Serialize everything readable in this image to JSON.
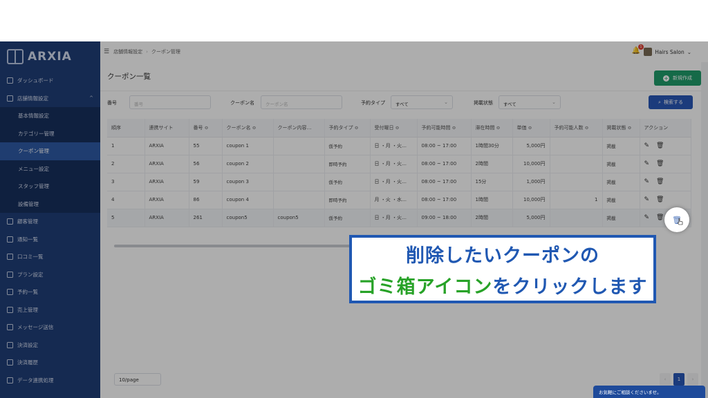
{
  "brand": "ARXIA",
  "sidebar": {
    "items": [
      {
        "label": "ダッシュボード"
      },
      {
        "label": "店舗情報設定",
        "expanded": true
      },
      {
        "label": "顧客管理"
      },
      {
        "label": "通知一覧"
      },
      {
        "label": "口コミ一覧"
      },
      {
        "label": "プラン設定"
      },
      {
        "label": "予約一覧"
      },
      {
        "label": "売上管理"
      },
      {
        "label": "メッセージ送信"
      },
      {
        "label": "決済設定"
      },
      {
        "label": "決済履歴"
      },
      {
        "label": "データ連携処理"
      }
    ],
    "sub_items": [
      {
        "label": "基本情報設定"
      },
      {
        "label": "カテゴリー管理"
      },
      {
        "label": "クーポン管理",
        "active": true
      },
      {
        "label": "メニュー設定"
      },
      {
        "label": "スタッフ管理"
      },
      {
        "label": "設備管理"
      }
    ]
  },
  "header": {
    "breadcrumb": [
      "店舗情報設定",
      "クーポン管理"
    ],
    "notification_count": "1",
    "account": "Hairs Salon"
  },
  "page": {
    "title": "クーポン一覧",
    "new_button": "新規作成",
    "search_button": "検索する"
  },
  "filters": {
    "number_label": "番号",
    "number_placeholder": "番号",
    "name_label": "クーポン名",
    "name_placeholder": "クーポン名",
    "type_label": "予約タイプ",
    "type_value": "すべて",
    "status_label": "掲載状態",
    "status_value": "すべて"
  },
  "table": {
    "columns": [
      "順序",
      "連携サイト",
      "番号 ≎",
      "クーポン名 ≎",
      "クーポン内容…",
      "予約タイプ ≎",
      "受付曜日 ≎",
      "予約可能時間 ≎",
      "滞在時間 ≎",
      "単価 ≎",
      "予約可能人数 ≎",
      "掲載状態 ≎",
      "アクション"
    ],
    "rows": [
      [
        "1",
        "ARXIA",
        "55",
        "coupon 1",
        "",
        "仮予約",
        "日 ・月 ・火…",
        "08:00 ~ 17:00",
        "1時間30分",
        "5,000円",
        "",
        "掲載"
      ],
      [
        "2",
        "ARXIA",
        "56",
        "coupon 2",
        "",
        "即時予約",
        "日 ・月 ・火…",
        "08:00 ~ 17:00",
        "2時間",
        "10,000円",
        "",
        "掲載"
      ],
      [
        "3",
        "ARXIA",
        "59",
        "coupon 3",
        "",
        "仮予約",
        "日 ・月 ・火…",
        "08:00 ~ 17:00",
        "15分",
        "1,000円",
        "",
        "掲載"
      ],
      [
        "4",
        "ARXIA",
        "86",
        "coupon 4",
        "",
        "即時予約",
        "月 ・火 ・水…",
        "08:00 ~ 17:00",
        "1時間",
        "10,000円",
        "1",
        "掲載"
      ],
      [
        "5",
        "ARXIA",
        "261",
        "coupon5",
        "coupon5",
        "仮予約",
        "日 ・月 ・火…",
        "09:00 ~ 18:00",
        "2時間",
        "5,000円",
        "",
        "掲載"
      ]
    ]
  },
  "pagination": {
    "page_size": "10/page",
    "current": "1"
  },
  "chat": "お気軽にご相談くださいませ。",
  "callout": {
    "line1": "削除したいクーポンの",
    "line2_green": "ゴミ箱アイコン",
    "line2_blue": "をクリックします"
  },
  "colors": {
    "sidebar": "#1f3f78",
    "accent_blue": "#2958b7",
    "new_green": "#1f9d6b",
    "callout_green": "#27a227"
  }
}
